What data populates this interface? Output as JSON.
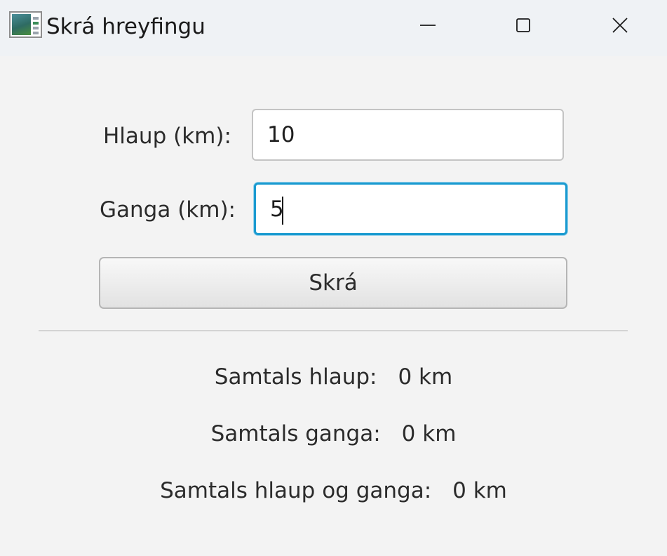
{
  "window": {
    "title": "Skrá hreyfingu",
    "controls": [
      "minimize-icon",
      "maximize-icon",
      "close-icon"
    ]
  },
  "form": {
    "run": {
      "label": "Hlaup (km):",
      "value": "10"
    },
    "walk": {
      "label": "Ganga (km):",
      "value": "5",
      "focused": true
    },
    "submit_label": "Skrá"
  },
  "summary": {
    "run": {
      "label": "Samtals hlaup:",
      "value": "0 km"
    },
    "walk": {
      "label": "Samtals ganga:",
      "value": "0 km"
    },
    "total": {
      "label": "Samtals hlaup og ganga:",
      "value": "0 km"
    }
  },
  "colors": {
    "focus_border": "#1a9ad0",
    "window_bg": "#f3f3f3",
    "titlebar_bg": "#eff2f5"
  }
}
